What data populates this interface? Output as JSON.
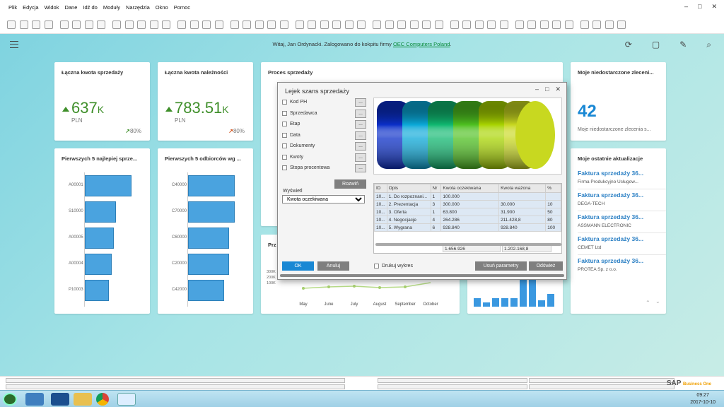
{
  "menu": [
    "Plik",
    "Edycja",
    "Widok",
    "Dane",
    "Idź do",
    "Moduły",
    "Narzędzia",
    "Okno",
    "Pomoc"
  ],
  "window_controls": {
    "minimize": "–",
    "restore": "□",
    "close": "✕"
  },
  "header": {
    "welcome_prefix": "Witaj, Jan Ordynacki. Zalogowano do kokpitu firmy ",
    "company_link": "OEC Computers Poland",
    "welcome_suffix": "."
  },
  "cards": {
    "sales": {
      "title": "Łączna kwota sprzedaży",
      "value": "637",
      "suffix": "K",
      "unit": "PLN",
      "pct": "80%"
    },
    "receivables": {
      "title": "Łączna kwota należności",
      "value": "783.51",
      "suffix": "K",
      "unit": "PLN",
      "pct": "80%"
    },
    "process": {
      "title": "Proces sprzedaży"
    },
    "undelivered": {
      "title": "Moje niedostarczone zleceni...",
      "value": "42",
      "sub": "Moje niedostarczone zlecenia s..."
    },
    "top_items": {
      "title": "Pierwszych 5 najlepiej sprze...",
      "bars": [
        {
          "label": "A00001",
          "v": 1.0
        },
        {
          "label": "S10000",
          "v": 0.66
        },
        {
          "label": "A00005",
          "v": 0.62
        },
        {
          "label": "A00004",
          "v": 0.58
        },
        {
          "label": "P10003",
          "v": 0.52
        }
      ]
    },
    "top_customers": {
      "title": "Pierwszych 5 odbiorców wg ...",
      "bars": [
        {
          "label": "C40000",
          "v": 1.0
        },
        {
          "label": "C70000",
          "v": 1.0
        },
        {
          "label": "C60000",
          "v": 0.88
        },
        {
          "label": "C20000",
          "v": 0.88
        },
        {
          "label": "C42000",
          "v": 0.78
        }
      ]
    },
    "przeglad": {
      "title": "Prz"
    },
    "updates": {
      "title": "Moje ostatnie aktualizacje",
      "items": [
        {
          "title": "Faktura sprzedaży 36...",
          "sub": "Firma Produkcyjno Usługow..."
        },
        {
          "title": "Faktura sprzedaży 36...",
          "sub": "DEGA-TECH"
        },
        {
          "title": "Faktura sprzedaży 36...",
          "sub": "ASSMANN ELECTRONIC"
        },
        {
          "title": "Faktura sprzedaży 36...",
          "sub": "CEMET Ltd"
        },
        {
          "title": "Faktura sprzedaży 36...",
          "sub": "PROTEA Sp. z o.o."
        }
      ]
    }
  },
  "line_chart": {
    "y_ticks": [
      "300K",
      "200K",
      "100K"
    ],
    "months": [
      "May",
      "June",
      "July",
      "August",
      "September",
      "October"
    ]
  },
  "chart_data": {
    "type": "bar",
    "note_series": "small bar chart in right-bottom card, values relative (unlabeled)",
    "values": [
      0.2,
      0.1,
      0.2,
      0.2,
      0.2,
      0.8,
      0.85,
      0.15,
      0.3
    ]
  },
  "dialog": {
    "title": "Lejek szans sprzedaży",
    "filters": [
      "Kod PH",
      "Sprzedawca",
      "Etap",
      "Data",
      "Dokumenty",
      "Kwoty",
      "Stopa procentowa"
    ],
    "dots": "...",
    "expand_button": "Rozwiń",
    "show_label": "Wyświetl",
    "show_selected": "Kwota oczekiwana",
    "columns": [
      "ID",
      "Opis",
      "Nr",
      "Kwota oczekiwana",
      "Kwota ważona",
      "%"
    ],
    "rows": [
      [
        "10...",
        "1. Do rozpoznani...",
        "1",
        "100.000",
        "",
        ""
      ],
      [
        "10...",
        "2. Prezentacja",
        "3",
        "300.000",
        "30.000",
        "10"
      ],
      [
        "10...",
        "3. Oferta",
        "1",
        "63.800",
        "31.900",
        "50"
      ],
      [
        "10...",
        "4. Negocjacje",
        "4",
        "264.286",
        "211.428,8",
        "80"
      ],
      [
        "10...",
        "5. Wygrana",
        "6",
        "928.840",
        "928.840",
        "100"
      ]
    ],
    "total_expected": "1.656.926",
    "total_weighted": "1.202.168,8",
    "ok_button": "OK",
    "cancel_button": "Anuluj",
    "print_chart": "Drukuj wykres",
    "remove_params": "Usuń parametry",
    "refresh_button": "Odśwież",
    "funnel_colors": [
      "#0b2fc8",
      "#0aa8d8",
      "#10b870",
      "#4ec020",
      "#a8d400",
      "#c8d820"
    ]
  },
  "brand": {
    "sap": "SAP",
    "one": "Business One"
  },
  "clock": {
    "time": "09:27",
    "date": "2017-10-10"
  }
}
